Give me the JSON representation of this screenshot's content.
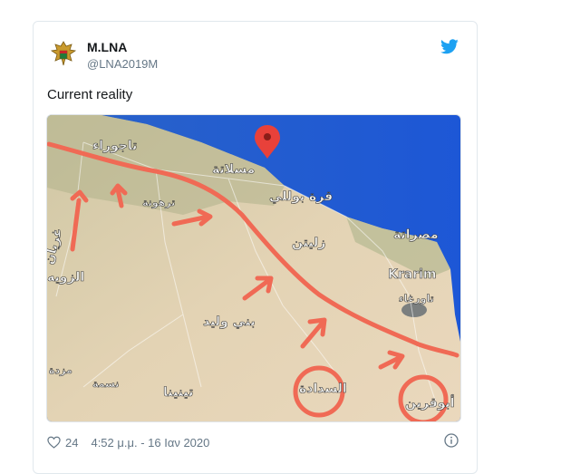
{
  "tweet": {
    "author_name": "M.LNA",
    "author_handle": "@LNA2019M",
    "text": "Current reality",
    "likes": "24",
    "timestamp": "4:52 μ.μ. - 16 Ιαν 2020",
    "icons": {
      "avatar": "eagle-emblem-avatar",
      "platform": "twitter-bird-icon",
      "like": "heart-icon",
      "info": "info-icon"
    },
    "colors": {
      "text": "#14171a",
      "muted": "#657786",
      "accent": "#1da1f2",
      "border": "#e1e8ed"
    }
  },
  "map": {
    "labels": {
      "tajoura": "تاجوراء",
      "msallata": "مسلاتة",
      "garabulli": "قرة بوللي",
      "tarhuna": "ترهونة",
      "misrata": "مصراتة",
      "zliten": "زليتن",
      "karim": "Krarim",
      "tawergha": "تاورغاء",
      "gharyan": "غريان",
      "zawiya": "الزويه",
      "bani_walid": "بني وليد",
      "mizda": "مزدة",
      "nesma": "نسمة",
      "tinnina": "تينينا",
      "sadada": "السدادة",
      "abugrein": "أبوقرين"
    },
    "colors": {
      "sea": "#1f5fd0",
      "land": "#dfcfae",
      "front_line": "#f06a55",
      "pin": "#e8413a"
    }
  }
}
